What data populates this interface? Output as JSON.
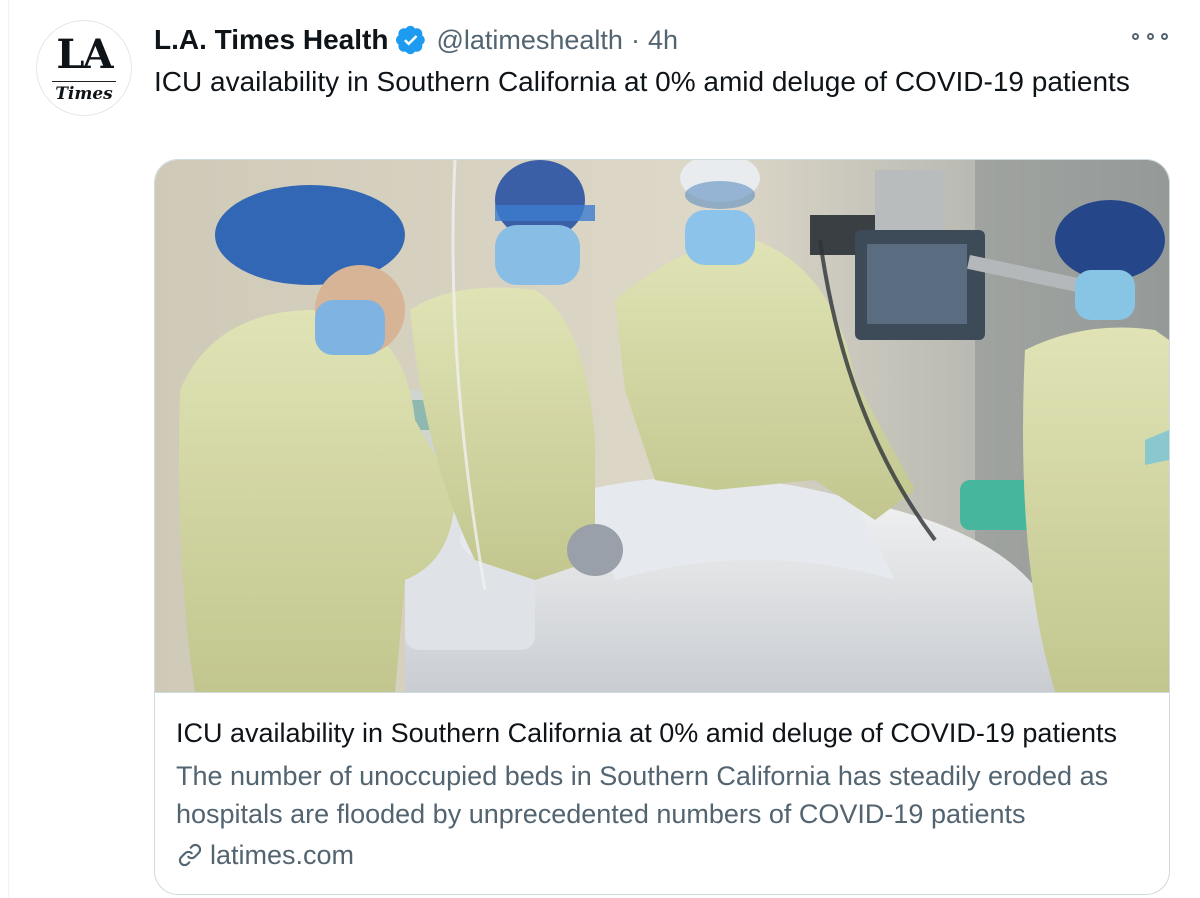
{
  "account": {
    "logo_top": "LA",
    "logo_bottom": "Times",
    "display_name": "L.A. Times Health",
    "handle": "@latimeshealth",
    "separator": "·",
    "time": "4h"
  },
  "icons": {
    "verified": "verified-badge-icon",
    "more": "more-options-icon",
    "link": "link-icon"
  },
  "colors": {
    "verified": "#1d9bf0",
    "secondary_text": "#536471",
    "border": "#cfd9de"
  },
  "tweet": {
    "text": "ICU availability in Southern California at 0% amid deluge of COVID-19 patients"
  },
  "card": {
    "title": "ICU availability in Southern California at 0% amid deluge of COVID-19 patients",
    "description": "The number of unoccupied beds in Southern California has steadily eroded as hospitals are flooded by unprecedented numbers of COVID-19 patients",
    "domain": "latimes.com"
  }
}
